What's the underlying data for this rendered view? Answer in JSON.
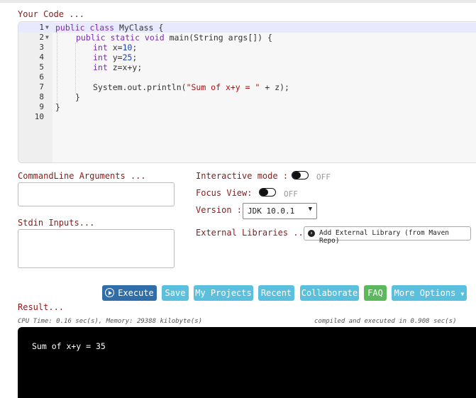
{
  "labels": {
    "your_code": "Your Code ...",
    "cmd_args": "CommandLine Arguments ...",
    "stdin": "Stdin Inputs...",
    "result": "Result...",
    "interactive": "Interactive mode :",
    "focus": "Focus View:",
    "version": "Version :",
    "ext_libs": "External Libraries ..."
  },
  "editor": {
    "line_numbers": [
      "1",
      "2",
      "3",
      "4",
      "5",
      "6",
      "7",
      "8",
      "9",
      "10"
    ],
    "lines": [
      {
        "t1": "public class ",
        "t2": "MyClass {"
      },
      {
        "t1": "public static void ",
        "t2": "main(String args[]) {"
      },
      {
        "t1": "int ",
        "t2": "x=",
        "t3": "10",
        ";": ";"
      },
      {
        "t1": "int ",
        "t2": "y=",
        "t3": "25",
        ";": ";"
      },
      {
        "t1": "int ",
        "t2": "z=x+y;"
      },
      {},
      {
        "a": "System.out.println(",
        "s": "\"Sum of x+y = \"",
        "b": " + z);"
      },
      {
        "a": "}"
      },
      {
        "a": "}"
      }
    ]
  },
  "toggles": {
    "interactive_state": "OFF",
    "focus_state": "OFF"
  },
  "version_select": {
    "value": "JDK 10.0.1",
    "arrow": "▼"
  },
  "maven": {
    "label": "Add External Library (from Maven Repo)"
  },
  "buttons": {
    "execute": "Execute",
    "save": "Save",
    "my_projects": "My Projects",
    "recent": "Recent",
    "collaborate": "Collaborate",
    "faq": "FAQ",
    "more": "More Options"
  },
  "stats": {
    "cpu": "CPU Time: 0.16 sec(s), Memory: 29388 kilobyte(s)",
    "compiled": "compiled and executed in 0.908 sec(s)"
  },
  "output": "Sum of x+y = 35",
  "colors": {
    "label": "#8b1a1a",
    "execute": "#2f6ea8",
    "cyan": "#5bc0de",
    "faq": "#5cb85c",
    "terminal": "#000000"
  }
}
